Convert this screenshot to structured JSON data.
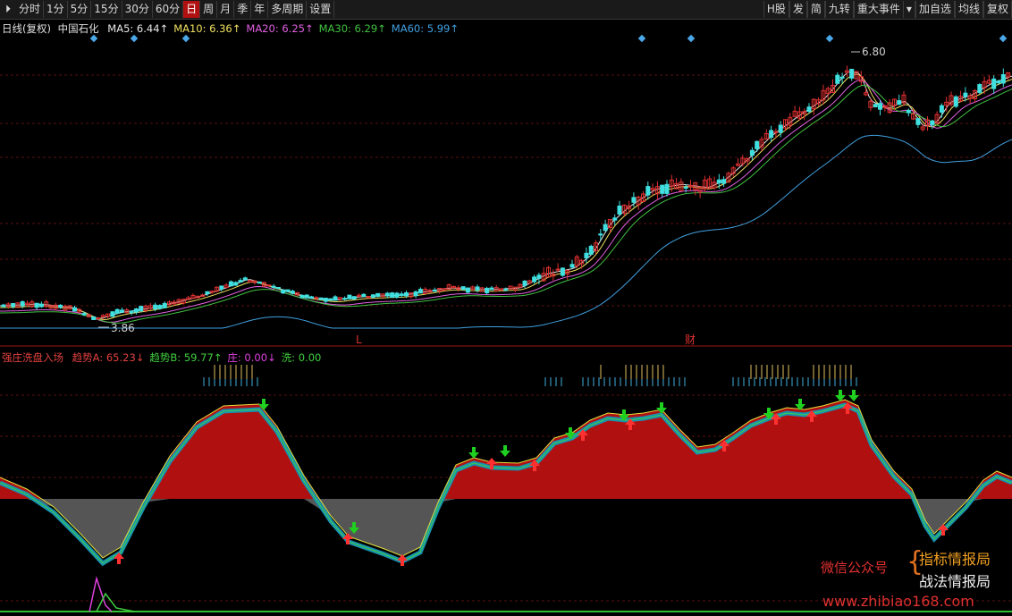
{
  "toolbar": {
    "left_items": [
      {
        "label": "分时",
        "active": false
      },
      {
        "label": "1分",
        "active": false
      },
      {
        "label": "5分",
        "active": false
      },
      {
        "label": "15分",
        "active": false
      },
      {
        "label": "30分",
        "active": false
      },
      {
        "label": "60分",
        "active": false
      },
      {
        "label": "日",
        "active": true
      },
      {
        "label": "周",
        "active": false
      },
      {
        "label": "月",
        "active": false
      },
      {
        "label": "季",
        "active": false
      },
      {
        "label": "年",
        "active": false
      },
      {
        "label": "多周期",
        "active": false
      },
      {
        "label": "设置",
        "active": false
      }
    ],
    "right_items": [
      "H股",
      "发",
      "简",
      "九转",
      "重大事件",
      "加自选",
      "均线",
      "复权"
    ]
  },
  "main_legend": {
    "period": "日线(复权)",
    "stock_name": "中国石化",
    "ma": [
      {
        "label": "MA5: 6.44↑",
        "color": "#e8e8e8"
      },
      {
        "label": "MA10: 6.36↑",
        "color": "#f0e060"
      },
      {
        "label": "MA20: 6.25↑",
        "color": "#e060e0"
      },
      {
        "label": "MA30: 6.29↑",
        "color": "#40c040"
      },
      {
        "label": "MA60: 5.99↑",
        "color": "#40a0e0"
      }
    ]
  },
  "price_annotations": {
    "high": "6.80",
    "low": "3.86",
    "marker_l": "L",
    "marker_cai": "财"
  },
  "indicator_legend": {
    "name": "强庄洗盘入场",
    "items": [
      {
        "label": "趋势A: 65.23↓",
        "color": "#e04040"
      },
      {
        "label": "趋势B: 59.77↑",
        "color": "#40d040"
      },
      {
        "label": "庄: 0.00↓",
        "color": "#e040e0"
      },
      {
        "label": "洗: 0.00",
        "color": "#40d040"
      }
    ]
  },
  "watermark": {
    "wechat": "微信公众号",
    "name1": "指标情报局",
    "name2": "战法情报局",
    "url": "www.zhibiao168.com"
  },
  "colors": {
    "up_candle": "#e03030",
    "down_candle": "#40e0e0",
    "bull_fill": "#b01010",
    "bear_fill": "#1890b0",
    "neg_fill": "#555555",
    "buy_arrow": "#ff3030",
    "sell_arrow": "#20d020"
  }
}
